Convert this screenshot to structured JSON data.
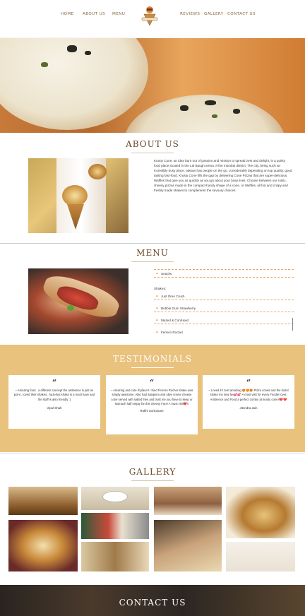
{
  "nav": {
    "left": [
      "HOME",
      "ABOUT US",
      "MENU"
    ],
    "right": [
      "REVIEWS",
      "GALLERY",
      "CONTACT US"
    ],
    "logo_icon": "krusty-cone-logo"
  },
  "about": {
    "title": "ABOUT US",
    "text": "Krusty Cone, an idea born out of passion and mission to spread zest and delight, is a quirky food place located in the Lal Baugh arena of the mumbai district. The city, being such an incredibly busy place, always has people on the go, considerably depending on top quality, good tasting fast-food. Krusty Cone fills the gap by delivering Cone Pizzas that are super-delicious. Waffles that give you as quickly as you go about your busy lives. Choose between our rustic, cheesy pizzas made in the compact-handy shape of a cone, or Waffles, all hot and crispy and freshly made shakes to complement the savoury choices."
  },
  "menu": {
    "title": "MENU",
    "items_top": [
      "Snacks"
    ],
    "shakes_heading": "Shakes:",
    "shakes": [
      "Just Oreo Crush",
      "Bubble Gum Strawberry",
      "Mazed & Confused",
      "Ferrero Rocher"
    ]
  },
  "testimonials": {
    "title": "TESTIMONIALS",
    "cards": [
      {
        "quote": "– Amazing food , a different concept the ambience is just on point , loved their shakes , hazelnut shake is a must have and the staff is also friendly :)",
        "author": "Vipul Shah"
      },
      {
        "quote": "– Amazing and cute lil place!! I tried Ferrero Rocher shake was simply awesome. Also had Jalapeno and olive creme cheese cone served with salted fries and trust me you have to keep ur stomach half empty for this cheesy Fun!! A must visit❤️!!",
        "author": "Rakhi Sonkusare"
      },
      {
        "quote": "– Loved it!! Just amazing 😍😍😍 Pizza cones and the hazel shake my new fav💕💕 A must visit for every Foodie lover. Ambience and Food a perfect combo at krusty cone!!❤️❤️",
        "author": "Jitendra Jain"
      }
    ]
  },
  "gallery": {
    "title": "GALLERY"
  },
  "contact": {
    "title": "CONTACT US"
  },
  "colors": {
    "accent": "#e9c27e",
    "title": "#6b4a2b",
    "nav": "#8a6a45"
  }
}
